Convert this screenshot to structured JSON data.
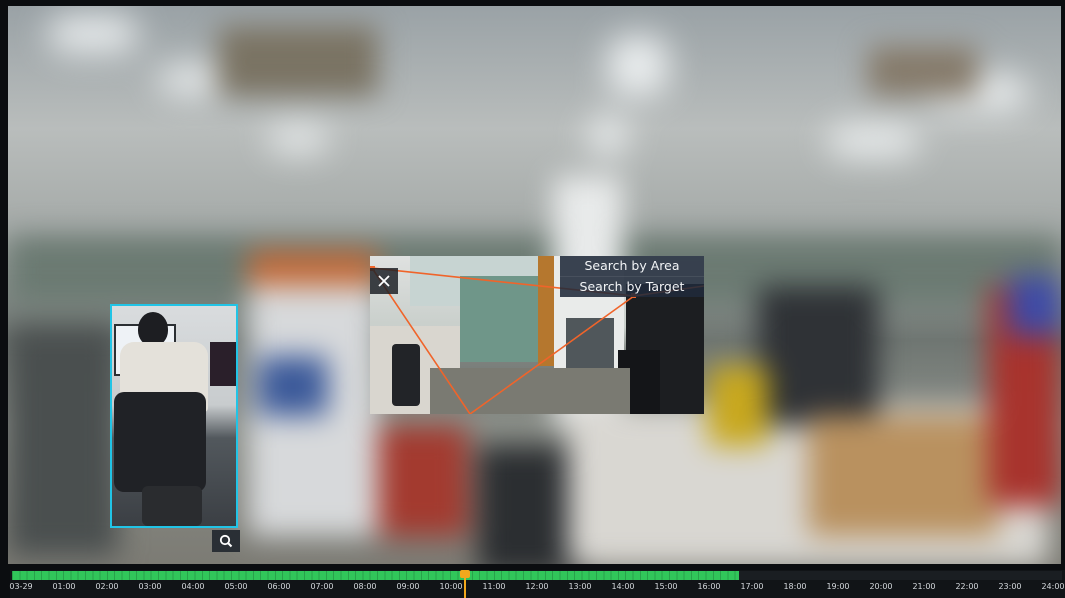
{
  "search_menu": {
    "items": [
      "Search by Area",
      "Search by Target"
    ]
  },
  "timeline": {
    "labels": [
      "03-29",
      "01:00",
      "02:00",
      "03:00",
      "04:00",
      "05:00",
      "06:00",
      "07:00",
      "08:00",
      "09:00",
      "10:00",
      "11:00",
      "12:00",
      "13:00",
      "14:00",
      "15:00",
      "16:00",
      "17:00",
      "18:00",
      "19:00",
      "20:00",
      "21:00",
      "22:00",
      "23:00",
      "24:00"
    ],
    "recorded_until_hour": 16.7,
    "playhead_hour": 10.3
  },
  "colors": {
    "target_box": "#21c4e6",
    "recorded": "#31c65a",
    "playhead": "#f2a81c",
    "area_lines": "#f0642a"
  },
  "icons": {
    "close": "close-icon",
    "zoom": "magnifier-icon"
  }
}
